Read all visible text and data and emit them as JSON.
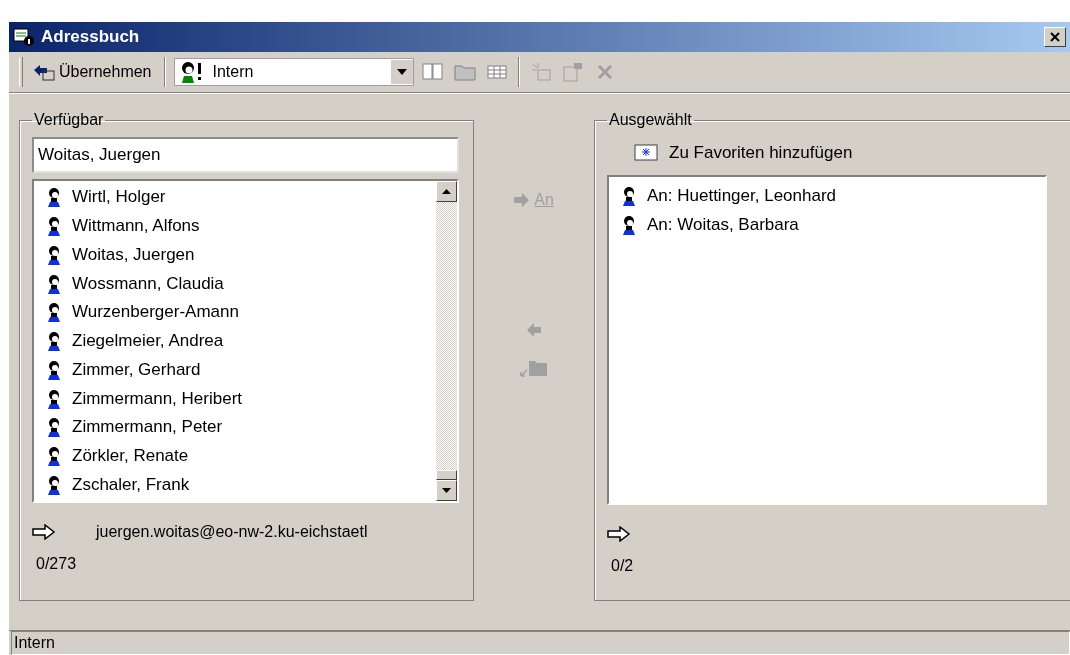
{
  "window": {
    "title": "Adressbuch"
  },
  "toolbar": {
    "apply_button": "Übernehmen",
    "address_list": {
      "value": "Intern"
    }
  },
  "available": {
    "title": "Verfügbar",
    "search": {
      "value": "Woitas, Juergen"
    },
    "items": [
      "Wirtl, Holger",
      "Wittmann, Alfons",
      "Woitas, Juergen",
      "Wossmann, Claudia",
      "Wurzenberger-Amann",
      "Ziegelmeier, Andrea",
      "Zimmer, Gerhard",
      "Zimmermann, Heribert",
      "Zimmermann, Peter",
      "Zörkler, Renate",
      "Zschaler, Frank"
    ],
    "email": "juergen.woitas@eo-nw-2.ku-eichstaetl",
    "count": "0/273"
  },
  "to_button": {
    "label": "An",
    "disabled": true
  },
  "selected": {
    "title": "Ausgewählt",
    "favorites_button": "Zu Favoriten hinzufügen",
    "items": [
      "An: Huettinger, Leonhard",
      "An: Woitas, Barbara"
    ],
    "count": "0/2"
  },
  "status_bar": "Intern"
}
